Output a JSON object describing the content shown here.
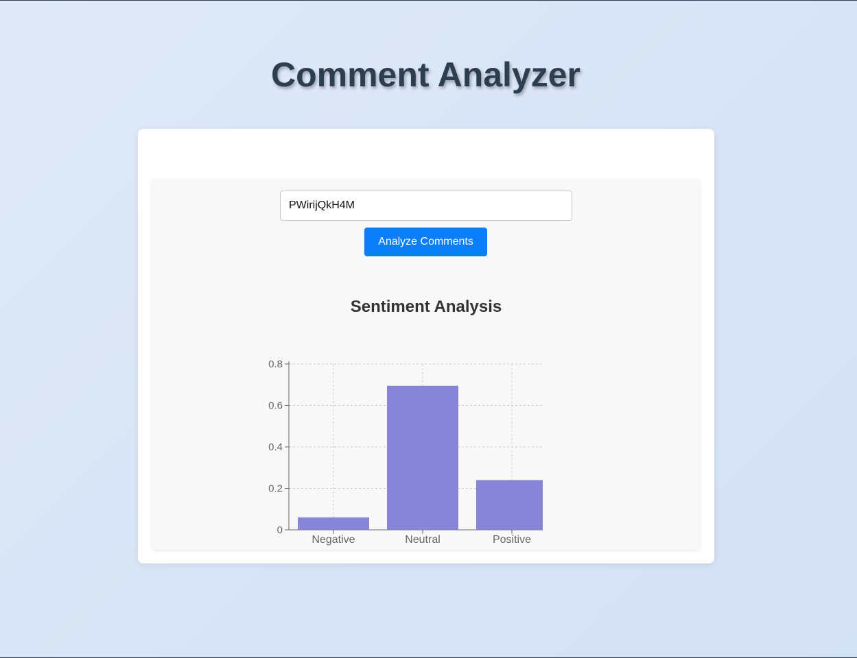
{
  "app": {
    "title": "Comment Analyzer"
  },
  "form": {
    "video_id_value": "PWirijQkH4M",
    "analyze_label": "Analyze Comments"
  },
  "colors": {
    "accent": "#0a7df8",
    "bar": "#8884d8"
  },
  "chart_data": {
    "type": "bar",
    "title": "Sentiment Analysis",
    "categories": [
      "Negative",
      "Neutral",
      "Positive"
    ],
    "series": [
      {
        "name": "value",
        "values": [
          0.06,
          0.695,
          0.24
        ]
      }
    ],
    "yticks": [
      "0",
      "0.2",
      "0.4",
      "0.6",
      "0.8"
    ],
    "ylim": [
      0,
      0.8
    ],
    "grid": true,
    "legend": "bottom"
  }
}
